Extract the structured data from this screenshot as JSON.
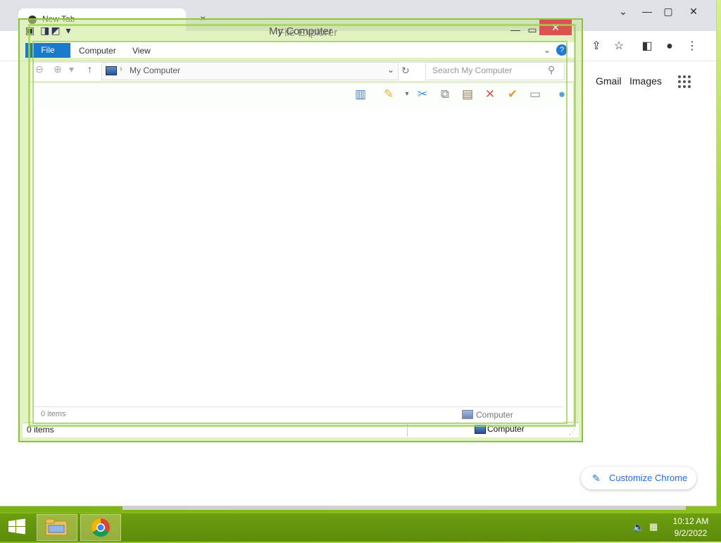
{
  "chrome": {
    "tab_title": "New Tab",
    "gmail": "Gmail",
    "images": "Images",
    "customize": "Customize Chrome"
  },
  "explorer": {
    "title": "My Computer",
    "title_ghost": "File Explorer",
    "ribbon_tabs": [
      "File",
      "Computer",
      "View"
    ],
    "address": "My Computer",
    "search_placeholder": "Search My Computer",
    "status_items": "0 items",
    "status_location": "Computer"
  },
  "taskbar": {
    "time": "10:12 AM",
    "date": "9/2/2022"
  },
  "colors": {
    "accent": "#1979ca",
    "close": "#d9534f",
    "desktop": "#8cc21f"
  }
}
